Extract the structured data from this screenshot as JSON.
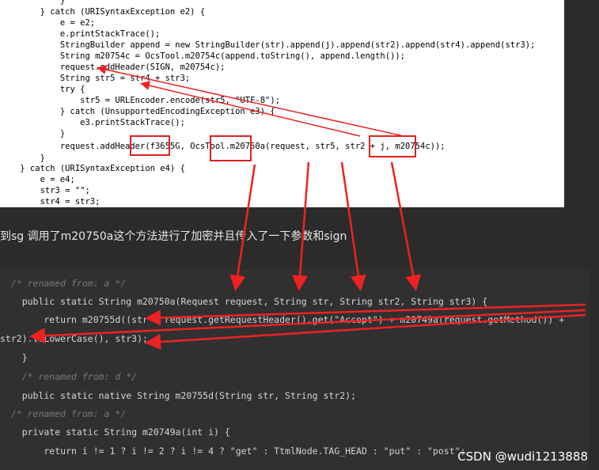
{
  "top_code": [
    "            }",
    "        } catch (URISyntaxException e2) {",
    "            e = e2;",
    "            e.printStackTrace();",
    "            StringBuilder append = new StringBuilder(str).append(j).append(str2).append(str4).append(str3);",
    "            String m20754c = OcsTool.m20754c(append.toString(), append.length());",
    "            request.addHeader(SIGN, m20754c);",
    "            String str5 = str4 + str3;",
    "            try {",
    "                str5 = URLEncoder.encode(str5, \"UTF-8\");",
    "            } catch (UnsupportedEncodingException e3) {",
    "                e3.printStackTrace();",
    "            }",
    "            request.addHeader(f3655G, OcsTool.m20750a(request, str5, str2 + j, m20754c));",
    "        }",
    "    } catch (URISyntaxException e4) {",
    "        e = e4;",
    "        str3 = \"\";",
    "        str4 = str3;"
  ],
  "caption": "到sg 调用了m20750a这个方法进行了加密并且传入了一下参数和sign",
  "decompiled_code": [
    "  /* renamed from: a */",
    "    public static String m20750a(Request request, String str, String str2, String str3) {",
    "        return m20755d((str + request.getRequestHeader().get(\"Accept\") + m20749a(request.getMethod()) +",
    "str2).toLowerCase(), str3);",
    "    }",
    "    /* renamed from: d */",
    "    public static native String m20755d(String str, String str2);",
    "  /* renamed from: a */",
    "    private static String m20749a(int i) {",
    "        return i != 1 ? i != 2 ? i != 4 ? \"get\" : TtmlNode.TAG_HEAD : \"put\" : \"post\";"
  ],
  "watermark": "CSDN @wudi1213888",
  "colors": {
    "highlight_box": "#e02020",
    "arrow": "#ee2222",
    "page_bg": "#2b2b2b"
  }
}
